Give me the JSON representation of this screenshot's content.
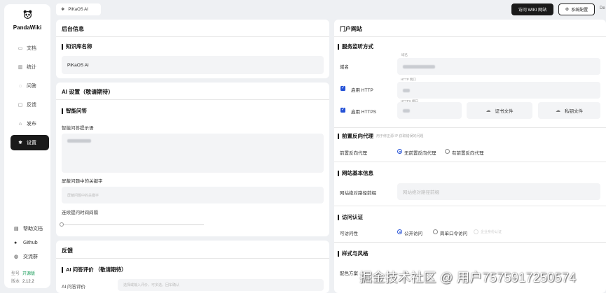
{
  "app": {
    "name": "PandaWiki"
  },
  "sidebar": {
    "items": [
      {
        "label": "文档",
        "icon": "document-icon"
      },
      {
        "label": "统计",
        "icon": "chart-icon"
      },
      {
        "label": "问答",
        "icon": "chat-icon"
      },
      {
        "label": "反馈",
        "icon": "feedback-icon"
      },
      {
        "label": "发布",
        "icon": "publish-icon"
      },
      {
        "label": "设置",
        "icon": "gear-icon",
        "active": true
      }
    ],
    "links": [
      {
        "label": "帮助文档",
        "icon": "help-doc-icon"
      },
      {
        "label": "Github",
        "icon": "github-icon"
      },
      {
        "label": "交流群",
        "icon": "group-icon"
      }
    ],
    "edition_label": "型号",
    "edition_value": "开源版",
    "version_label": "版本",
    "version_value": "2.12.2"
  },
  "topbar": {
    "kb_tab": "PiKaOS AI",
    "visit_wiki": "访问 WIKI 网站",
    "system_config": "系统配置",
    "edge_text": "De"
  },
  "left_panel": {
    "title": "后台信息",
    "kb_name_section": "知识库名称",
    "kb_name_value": "PiKaOS AI"
  },
  "ai_panel": {
    "title": "AI 设置（敬请期待）",
    "smart_qa_section": "智能问答",
    "prompt_label": "智能问答提示语",
    "block_words_label": "屏蔽问题中的关键字",
    "block_words_placeholder": "屏蔽问题中的关键字",
    "interval_label": "连续提问时间间隔"
  },
  "feedback_panel": {
    "title": "反馈",
    "ai_eval_section": "AI 问答评价 （敬请期待）",
    "ai_eval_label": "AI 问答评价",
    "ai_eval_placeholder": "选择或输入评价，可多选，回车确认"
  },
  "portal_panel": {
    "title": "门户网站",
    "listen_section": "服务监听方式",
    "domain_label": "域名",
    "domain_mini": "域名",
    "http_label": "启用 HTTP",
    "http_mini": "HTTP 端口",
    "https_label": "启用 HTTPS",
    "https_mini": "HTTPS 端口",
    "cert_file": "证书文件",
    "key_file": "私钥文件",
    "proxy_section": "前置反向代理",
    "proxy_hint": "用于修正源 IP 获取错误的问题",
    "proxy_label": "前置反向代理",
    "proxy_options": [
      "无前置反向代理",
      "有前置反向代理"
    ],
    "site_section": "网站基本信息",
    "site_path_label": "网站绝对路径前缀",
    "site_path_placeholder": "网站绝对路径前缀",
    "auth_section": "访问认证",
    "visibility_label": "可访问性",
    "visibility_options": [
      "公开访问",
      "简单口令访问",
      "企业身份认证"
    ],
    "style_section": "样式与风格",
    "color_label": "配色方案"
  },
  "watermark": "掘金技术社区 @ 用户7575917250574",
  "colors": {
    "accent": "#2451d6",
    "dark": "#1a1a1a",
    "panel_bg": "#ffffff",
    "page_bg": "#eef0f3"
  }
}
